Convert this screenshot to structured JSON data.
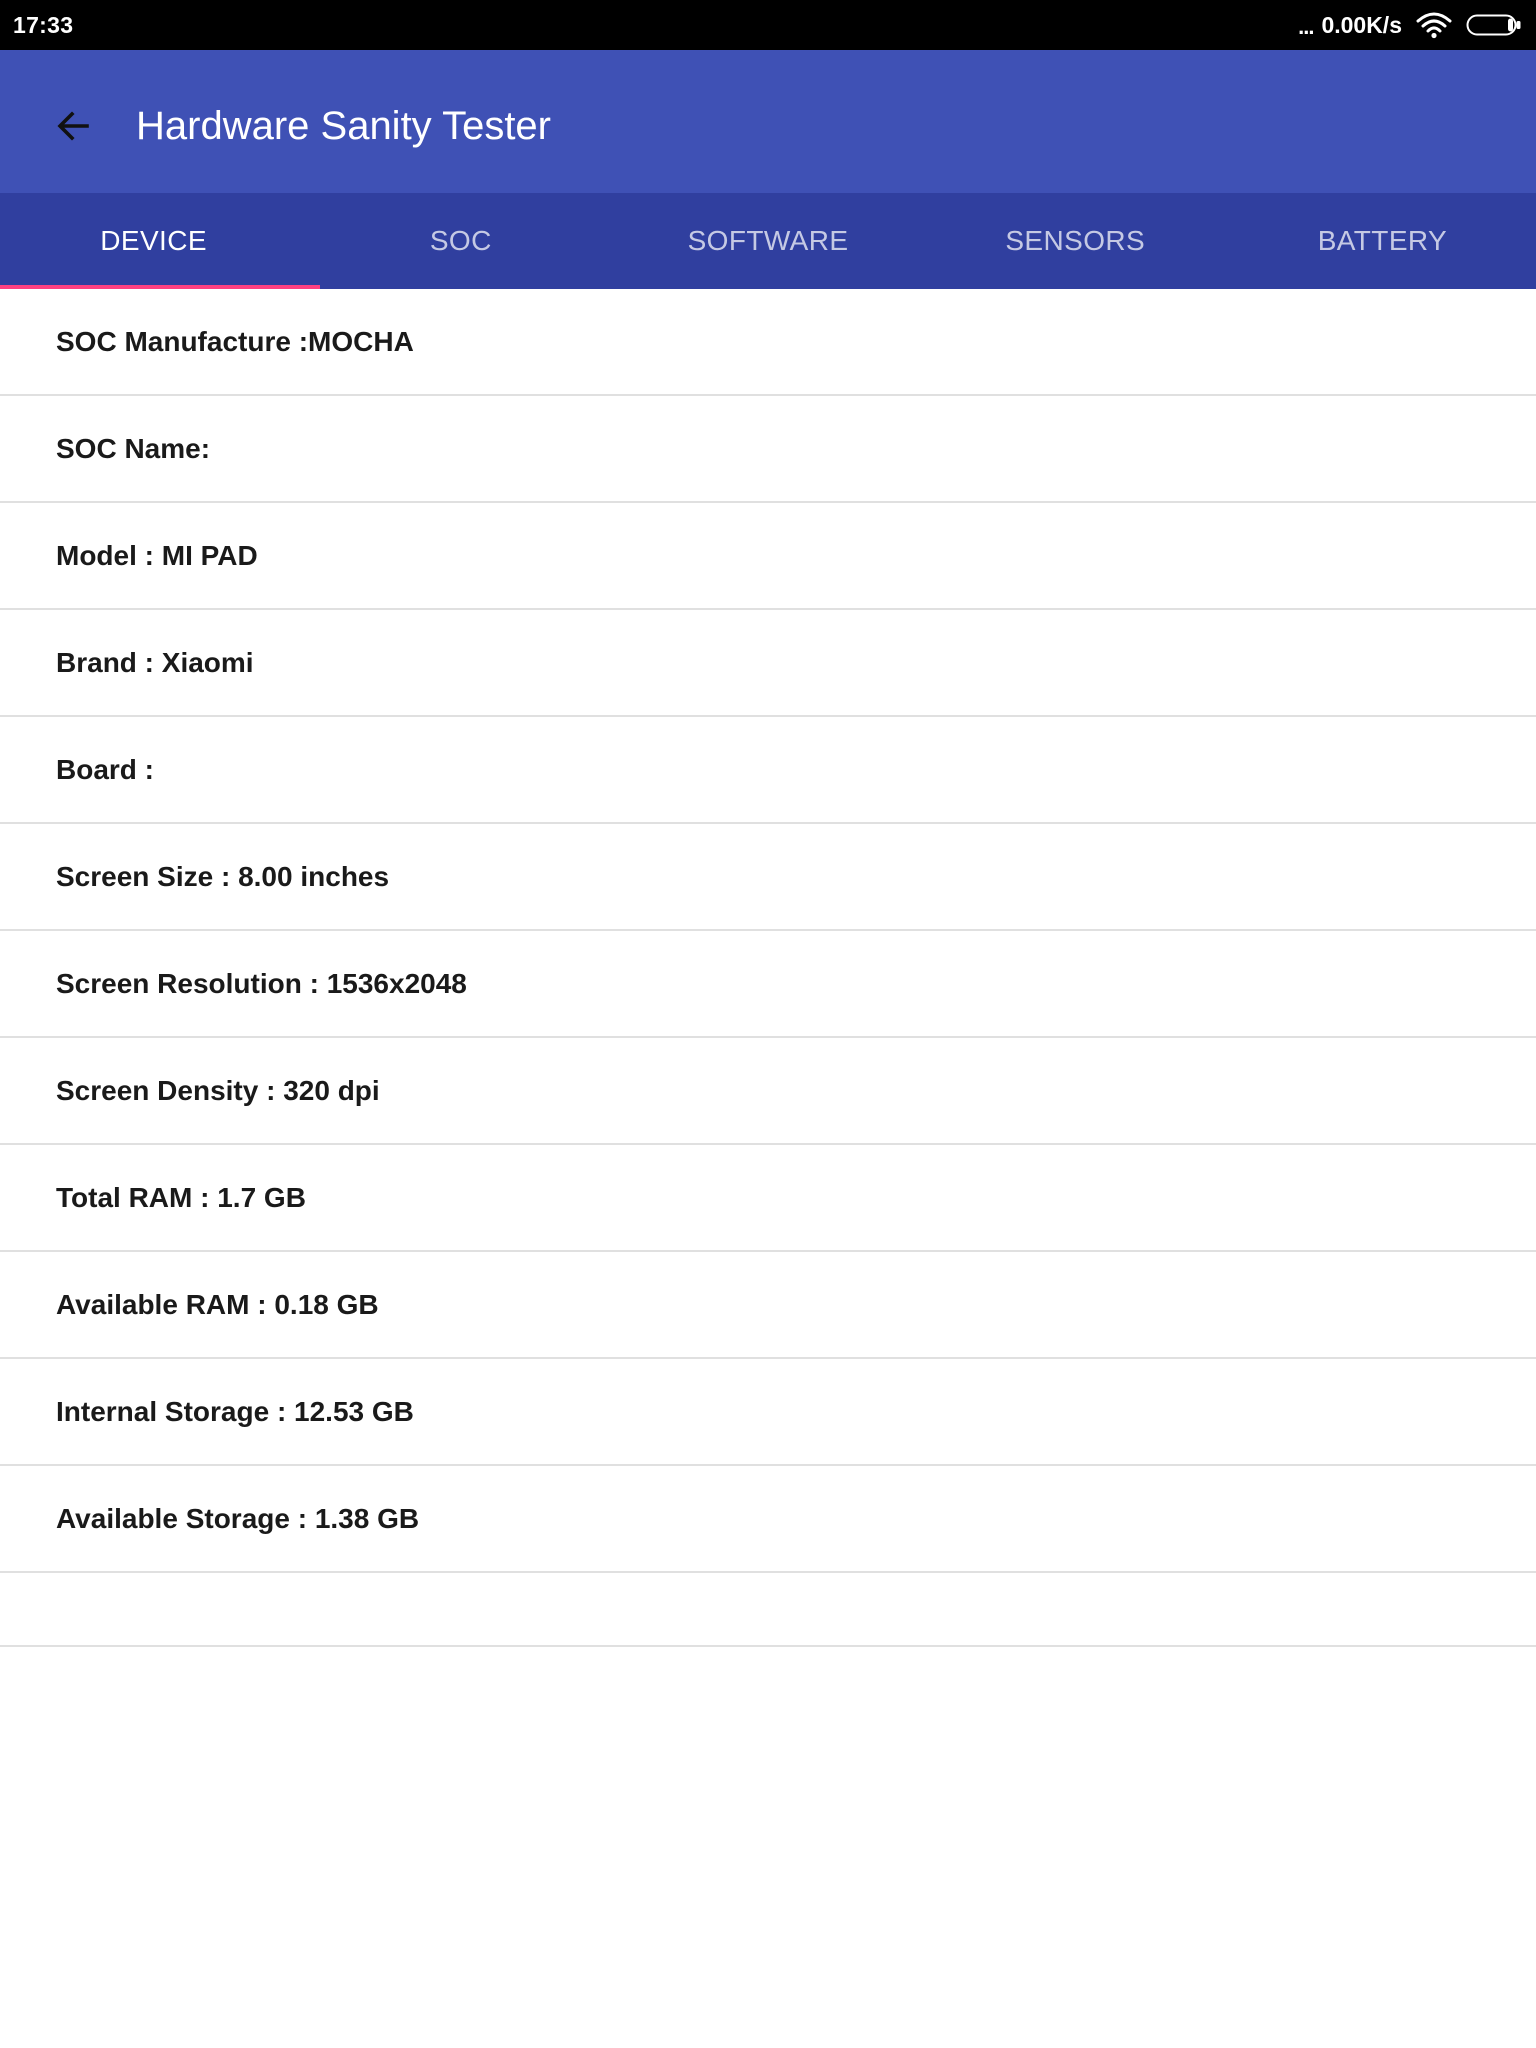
{
  "status_bar": {
    "time": "17:33",
    "dots": "...",
    "network_speed": "0.00K/s",
    "icons": [
      "wifi-icon",
      "battery-icon"
    ]
  },
  "app_bar": {
    "back_icon": "arrow-back-icon",
    "title": "Hardware Sanity Tester",
    "background_color": "#3F51B5"
  },
  "tabs": {
    "background_color": "#303F9F",
    "indicator_color": "#FF4081",
    "active_index": 0,
    "items": [
      {
        "label": "DEVICE"
      },
      {
        "label": "SOC"
      },
      {
        "label": "SOFTWARE"
      },
      {
        "label": "SENSORS"
      },
      {
        "label": "BATTERY"
      }
    ]
  },
  "device_info": {
    "rows": [
      "SOC Manufacture :MOCHA",
      "SOC Name:",
      "Model : MI PAD",
      "Brand : Xiaomi",
      "Board :",
      "Screen Size : 8.00 inches",
      "Screen Resolution : 1536x2048",
      "Screen Density : 320 dpi",
      "Total RAM : 1.7 GB",
      "Available RAM : 0.18 GB",
      "Internal Storage : 12.53 GB",
      "Available Storage : 1.38 GB",
      ""
    ]
  }
}
